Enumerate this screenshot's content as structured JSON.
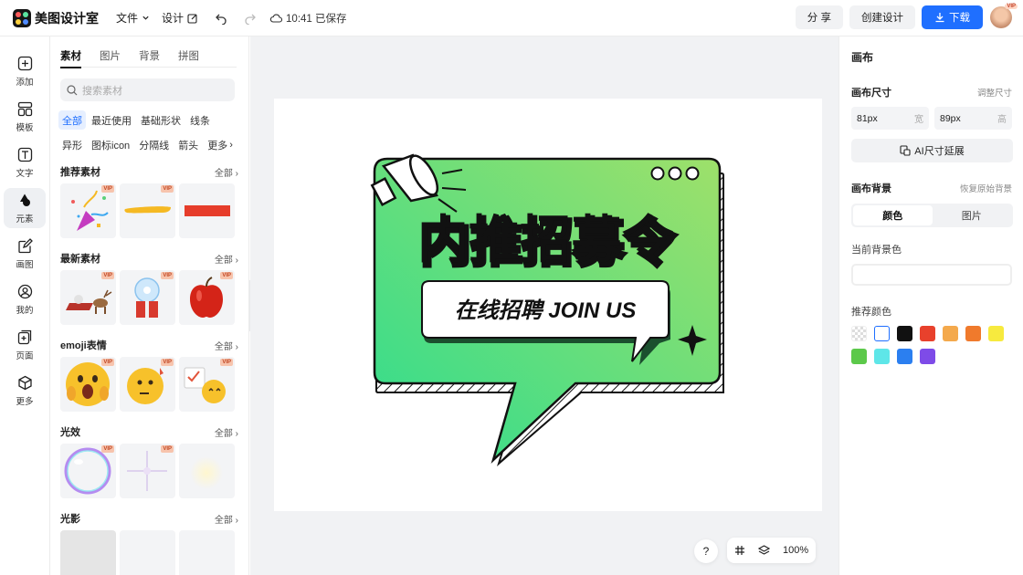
{
  "app": {
    "name": "美图设计室"
  },
  "topbar": {
    "file_menu": "文件",
    "design_menu": "设计",
    "save_status": "10:41 已保存",
    "share": "分 享",
    "create": "创建设计",
    "download": "下载",
    "avatar_badge": "VIP"
  },
  "leftnav": [
    {
      "label": "添加",
      "icon": "plus-square-icon"
    },
    {
      "label": "模板",
      "icon": "template-icon"
    },
    {
      "label": "文字",
      "icon": "text-icon"
    },
    {
      "label": "元素",
      "icon": "shapes-icon",
      "active": true
    },
    {
      "label": "画图",
      "icon": "pencil-icon"
    },
    {
      "label": "我的",
      "icon": "user-icon"
    },
    {
      "label": "页面",
      "icon": "page-add-icon"
    },
    {
      "label": "更多",
      "icon": "cube-icon"
    }
  ],
  "assets": {
    "tabs": [
      "素材",
      "图片",
      "背景",
      "拼图"
    ],
    "search_placeholder": "搜索素材",
    "chips": [
      "全部",
      "最近使用",
      "基础形状",
      "线条",
      "异形",
      "图标icon",
      "分隔线",
      "箭头",
      "更多"
    ],
    "vip": "VIP",
    "sections": [
      {
        "title": "推荐素材",
        "more": "全部"
      },
      {
        "title": "最新素材",
        "more": "全部"
      },
      {
        "title": "emoji表情",
        "more": "全部"
      },
      {
        "title": "光效",
        "more": "全部"
      },
      {
        "title": "光影",
        "more": "全部"
      }
    ]
  },
  "canvas": {
    "headline": "内推招募令",
    "subline": "在线招聘 JOIN US",
    "zoom": "100%",
    "help": "?"
  },
  "right": {
    "title": "画布",
    "size_label": "画布尺寸",
    "adjust_size": "调整尺寸",
    "width_value": "81px",
    "width_unit": "宽",
    "height_value": "89px",
    "height_unit": "高",
    "ai_extend": "AI尺寸延展",
    "bg_label": "画布背景",
    "restore_bg": "恢复原始背景",
    "seg_color": "颜色",
    "seg_image": "图片",
    "current_bg": "当前背景色",
    "recommended": "推荐颜色",
    "colors": [
      "transparent",
      "#ffffff",
      "#111111",
      "#e8412c",
      "#f4a94c",
      "#f07a2c",
      "#f7ea3e",
      "#5cc94a",
      "#5ee6e8",
      "#2b7ff0",
      "#7e4be8"
    ]
  }
}
